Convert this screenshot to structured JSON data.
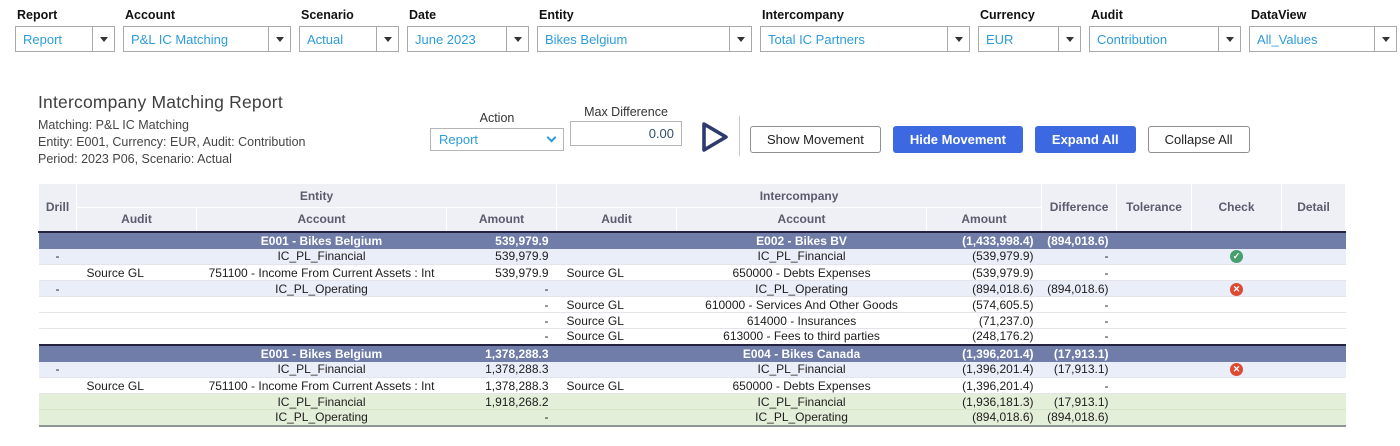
{
  "colors": {
    "link_blue": "#2D9CDB",
    "button_blue": "#3C69E1",
    "group_row_bg": "#6F7DA8",
    "level1_row_bg": "#EAEEF8",
    "total_row_bg": "#E4EFD9",
    "check_green": "#46A06E",
    "cross_red": "#DD4A32",
    "play_navy": "#2E3A6E"
  },
  "filters": [
    {
      "label": "Report",
      "value": "Report"
    },
    {
      "label": "Account",
      "value": "P&L IC Matching"
    },
    {
      "label": "Scenario",
      "value": "Actual"
    },
    {
      "label": "Date",
      "value": "June 2023"
    },
    {
      "label": "Entity",
      "value": "Bikes Belgium"
    },
    {
      "label": "Intercompany",
      "value": "Total IC Partners"
    },
    {
      "label": "Currency",
      "value": "EUR"
    },
    {
      "label": "Audit",
      "value": "Contribution"
    },
    {
      "label": "DataView",
      "value": "All_Values"
    }
  ],
  "report": {
    "title": "Intercompany Matching Report",
    "subtitle1": "Matching: P&L IC Matching",
    "subtitle2": "Entity: E001, Currency: EUR, Audit: Contribution",
    "subtitle3": "Period: 2023 P06, Scenario: Actual"
  },
  "controls": {
    "action_label": "Action",
    "action_value": "Report",
    "max_difference_label": "Max Difference",
    "max_difference_value": "0.00",
    "buttons": [
      {
        "label": "Show Movement",
        "variant": "outline"
      },
      {
        "label": "Hide Movement",
        "variant": "primary"
      },
      {
        "label": "Expand All",
        "variant": "primary"
      },
      {
        "label": "Collapse All",
        "variant": "outline"
      }
    ]
  },
  "table": {
    "header": {
      "drill": "Drill",
      "entity_group": "Entity",
      "intercompany_group": "Intercompany",
      "audit": "Audit",
      "account": "Account",
      "amount": "Amount",
      "difference": "Difference",
      "tolerance": "Tolerance",
      "check": "Check",
      "detail": "Detail"
    },
    "rows": [
      {
        "type": "group",
        "e_account": "E001 - Bikes Belgium",
        "e_amount": "539,979.9",
        "i_account": "E002 - Bikes BV",
        "i_amount": "(1,433,998.4)",
        "difference": "(894,018.6)"
      },
      {
        "type": "level1",
        "drill": "-",
        "e_account": "IC_PL_Financial",
        "e_amount": "539,979.9",
        "i_account": "IC_PL_Financial",
        "i_amount": "(539,979.9)",
        "difference": "-",
        "check": "pass"
      },
      {
        "type": "detail",
        "e_audit": "Source GL",
        "e_account": "751100 - Income From Current Assets : Int",
        "e_amount": "539,979.9",
        "i_audit": "Source GL",
        "i_account": "650000 - Debts Expenses",
        "i_amount": "(539,979.9)",
        "difference": "-"
      },
      {
        "type": "level1",
        "drill": "-",
        "e_account": "IC_PL_Operating",
        "e_amount": "-",
        "i_account": "IC_PL_Operating",
        "i_amount": "(894,018.6)",
        "difference": "(894,018.6)",
        "check": "fail"
      },
      {
        "type": "detail",
        "e_amount": "-",
        "i_audit": "Source GL",
        "i_account": "610000 - Services And Other Goods",
        "i_amount": "(574,605.5)",
        "difference": "-"
      },
      {
        "type": "detail",
        "e_amount": "-",
        "i_audit": "Source GL",
        "i_account": "614000 - Insurances",
        "i_amount": "(71,237.0)",
        "difference": "-"
      },
      {
        "type": "detail",
        "e_amount": "-",
        "i_audit": "Source GL",
        "i_account": "613000 - Fees to third parties",
        "i_amount": "(248,176.2)",
        "difference": "-"
      },
      {
        "type": "group",
        "e_account": "E001 - Bikes Belgium",
        "e_amount": "1,378,288.3",
        "i_account": "E004 - Bikes Canada",
        "i_amount": "(1,396,201.4)",
        "difference": "(17,913.1)"
      },
      {
        "type": "level1",
        "drill": "-",
        "e_account": "IC_PL_Financial",
        "e_amount": "1,378,288.3",
        "i_account": "IC_PL_Financial",
        "i_amount": "(1,396,201.4)",
        "difference": "(17,913.1)",
        "check": "fail"
      },
      {
        "type": "detail",
        "e_audit": "Source GL",
        "e_account": "751100 - Income From Current Assets : Int",
        "e_amount": "1,378,288.3",
        "i_audit": "Source GL",
        "i_account": "650000 - Debts Expenses",
        "i_amount": "(1,396,201.4)",
        "difference": "-"
      },
      {
        "type": "total",
        "e_account": "IC_PL_Financial",
        "e_amount": "1,918,268.2",
        "i_account": "IC_PL_Financial",
        "i_amount": "(1,936,181.3)",
        "difference": "(17,913.1)"
      },
      {
        "type": "total",
        "e_account": "IC_PL_Operating",
        "e_amount": "-",
        "i_account": "IC_PL_Operating",
        "i_amount": "(894,018.6)",
        "difference": "(894,018.6)"
      }
    ]
  }
}
